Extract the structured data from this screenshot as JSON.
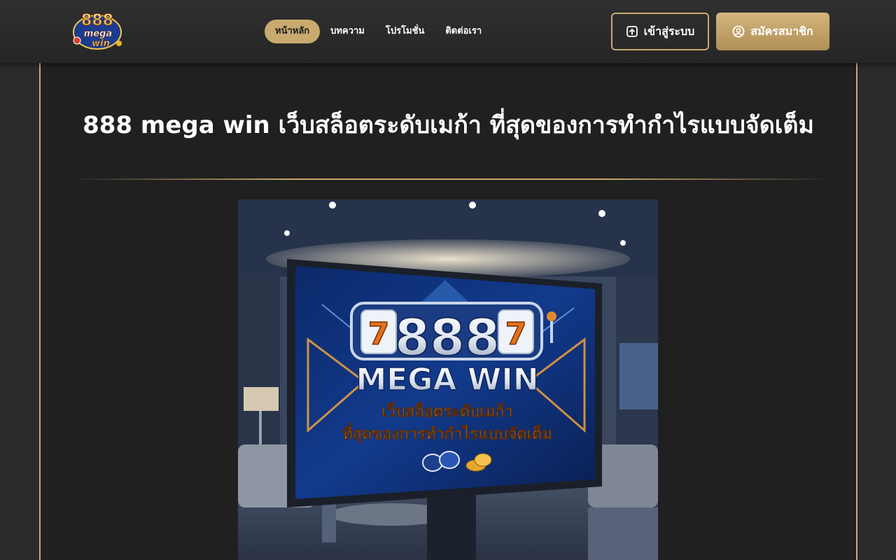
{
  "brand": {
    "logo_top": "888",
    "logo_middle": "mega",
    "logo_bottom": "win"
  },
  "nav": {
    "items": [
      {
        "label": "หน้าหลัก",
        "active": true
      },
      {
        "label": "บทความ",
        "active": false
      },
      {
        "label": "โปรโมชั่น",
        "active": false
      },
      {
        "label": "ติดต่อเรา",
        "active": false
      }
    ]
  },
  "auth": {
    "login_label": "เข้าสู่ระบบ",
    "register_label": "สมัครสมาชิก"
  },
  "main": {
    "title": "888 mega win เว็บสล็อตระดับเมก้า ที่สุดของการทำกำไรแบบจัดเต็ม"
  },
  "hero_image": {
    "headline": "888",
    "subheadline": "MEGA WIN",
    "reel_symbol": "7",
    "caption_line1": "เว็บสล็อตระดับเมก้า",
    "caption_line2": "ที่สุดของการทำกำไรแบบจัดเต็ม"
  },
  "colors": {
    "accent_gold": "#c9aa6e",
    "header_bg": "#2c2c2c",
    "content_bg": "#202020"
  }
}
